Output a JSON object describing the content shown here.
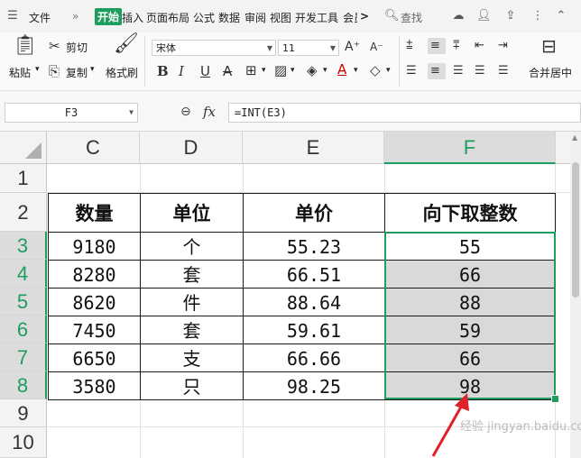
{
  "menubar": {
    "file": "文件",
    "tabs": [
      "开始",
      "插入",
      "页面布局",
      "公式",
      "数据",
      "审阅",
      "视图",
      "开发工具",
      "会员"
    ],
    "search": "查找",
    "more": ">"
  },
  "ribbon": {
    "paste": "粘贴",
    "cut": "剪切",
    "copy": "复制",
    "format_painter": "格式刷",
    "font_name": "宋体",
    "font_size": "11",
    "merge_center": "合并居中"
  },
  "formula_bar": {
    "name_box": "F3",
    "fx": "fx",
    "formula": "=INT(E3)"
  },
  "sheet": {
    "columns": [
      "C",
      "D",
      "E",
      "F"
    ],
    "rows": [
      "1",
      "2",
      "3",
      "4",
      "5",
      "6",
      "7",
      "8",
      "9",
      "10"
    ],
    "header": [
      "数量",
      "单位",
      "单价",
      "向下取整数"
    ],
    "data": [
      [
        "9180",
        "个",
        "55.23",
        "55"
      ],
      [
        "8280",
        "套",
        "66.51",
        "66"
      ],
      [
        "8620",
        "件",
        "88.64",
        "88"
      ],
      [
        "7450",
        "套",
        "59.61",
        "59"
      ],
      [
        "6650",
        "支",
        "66.66",
        "66"
      ],
      [
        "3580",
        "只",
        "98.25",
        "98"
      ]
    ]
  },
  "watermark": "经验 jingyan.baidu.com",
  "colors": {
    "accent": "#1e9e5e",
    "selected_fill": "#d9d9d9",
    "arrow": "#e0202a"
  }
}
